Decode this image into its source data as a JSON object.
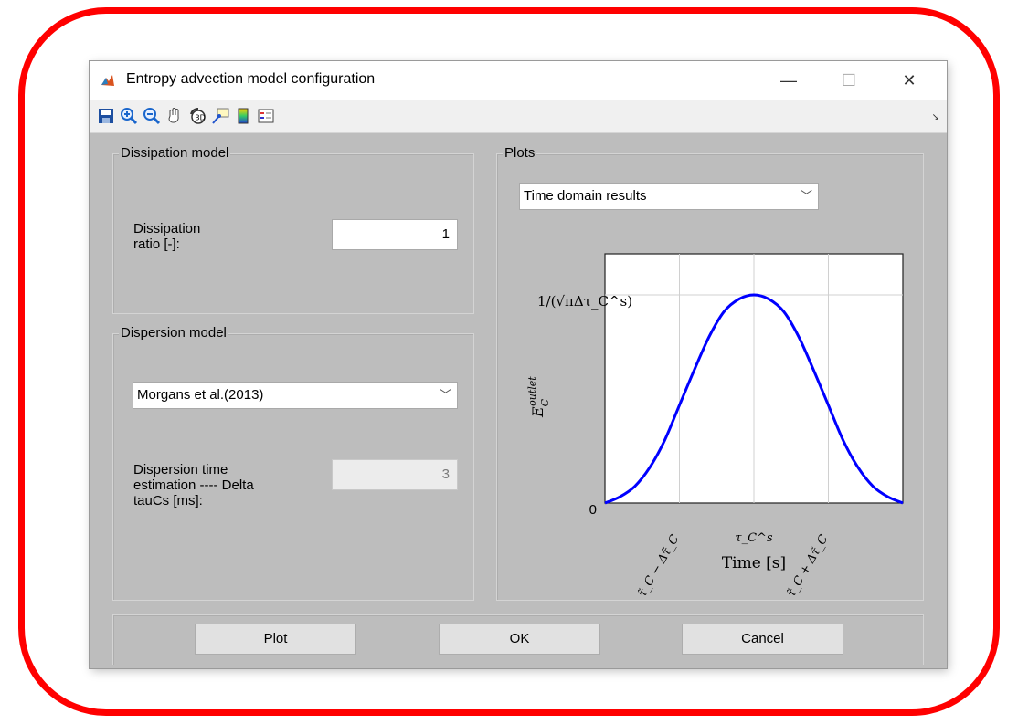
{
  "window": {
    "title": "Entropy advection model configuration",
    "minimize_glyph": "—",
    "maximize_glyph": "☐",
    "close_glyph": "✕"
  },
  "toolbar": {
    "icons": [
      "save-icon",
      "zoom-in-icon",
      "zoom-out-icon",
      "pan-icon",
      "rotate-3d-icon",
      "data-cursor-icon",
      "colorbar-icon",
      "legend-icon"
    ],
    "overflow_glyph": "↘"
  },
  "dissipation": {
    "title": "Dissipation model",
    "ratio_label_line1": "Dissipation",
    "ratio_label_line2": "ratio [-]:",
    "ratio_value": "1"
  },
  "dispersion": {
    "title": "Dispersion model",
    "model_selected": "Morgans et al.(2013)",
    "time_label_line1": "Dispersion time",
    "time_label_line2": "estimation ---- Delta",
    "time_label_line3": "tauCs [ms]:",
    "time_value": "3"
  },
  "plots": {
    "title": "Plots",
    "plot_type_selected": "Time domain results"
  },
  "chart_data": {
    "type": "line",
    "ylabel": "E_C^outlet",
    "xlabel": "Time [s]",
    "y_tick_labels": [
      "0",
      "1/(√πΔτ_C^s)"
    ],
    "x_tick_labels": [
      "τ̃_C − Δτ̃_C",
      "τ_C^s",
      "τ̃_C + Δτ̃_C"
    ],
    "x": [
      0,
      0.05,
      0.1,
      0.15,
      0.2,
      0.25,
      0.3,
      0.35,
      0.4,
      0.45,
      0.5,
      0.55,
      0.6,
      0.65,
      0.7,
      0.75,
      0.8,
      0.85,
      0.9,
      0.95,
      1.0
    ],
    "values": [
      0.0,
      0.03,
      0.08,
      0.17,
      0.3,
      0.47,
      0.64,
      0.8,
      0.92,
      0.98,
      1.0,
      0.98,
      0.92,
      0.8,
      0.64,
      0.47,
      0.3,
      0.17,
      0.08,
      0.03,
      0.0
    ],
    "grid": true,
    "series_color": "#0000ff"
  },
  "buttons": {
    "plot": "Plot",
    "ok": "OK",
    "cancel": "Cancel"
  }
}
